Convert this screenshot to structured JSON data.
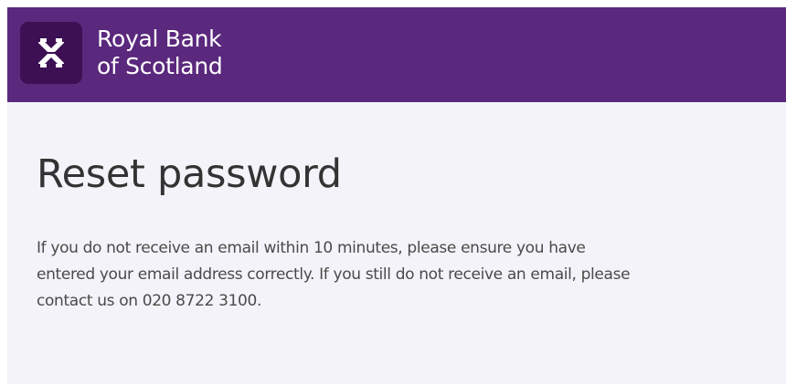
{
  "header": {
    "brand_line1": "Royal Bank",
    "brand_line2": "of Scotland",
    "logo_icon": "rbs-daisy-icon",
    "colors": {
      "header_bg": "#5a287d",
      "logo_bg": "#3c1053",
      "page_bg": "#f4f3f9"
    }
  },
  "main": {
    "title": "Reset password",
    "message": "If you do not receive an email within 10 minutes, please ensure you have entered your email address correctly. If you still do not receive an email, please contact us on 020 8722 3100."
  }
}
